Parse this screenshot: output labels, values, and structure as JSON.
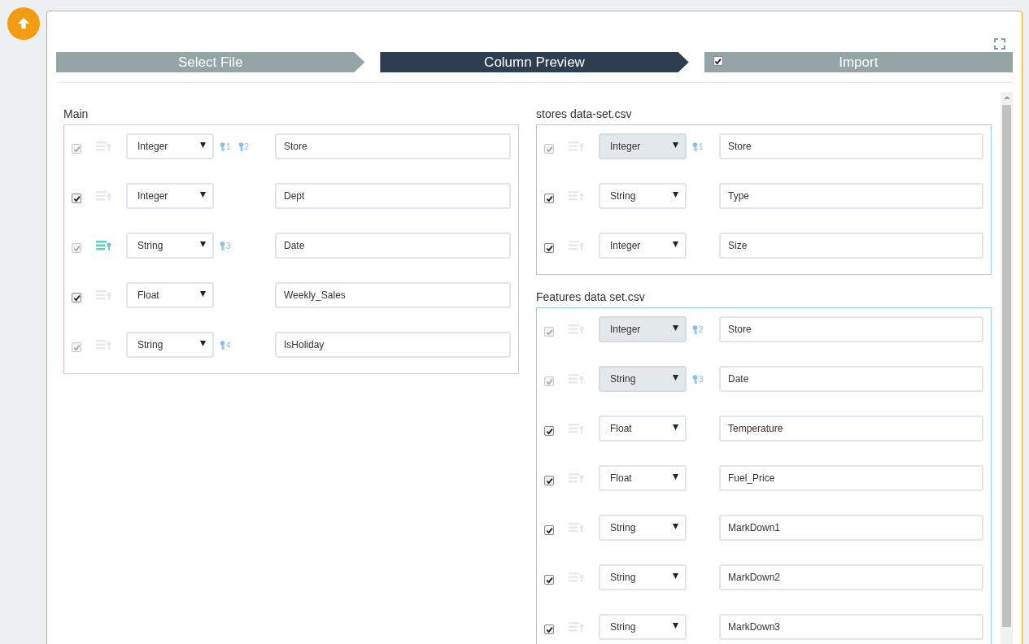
{
  "steps": [
    {
      "label": "Select File",
      "selected": false
    },
    {
      "label": "Column Preview",
      "selected": true
    },
    {
      "label": "Import",
      "selected": false,
      "checked": true
    }
  ],
  "panels": [
    {
      "kind": "main",
      "title": "Main",
      "rows": [
        {
          "checked": true,
          "checkbox_disabled": true,
          "indexed": false,
          "type": "Integer",
          "type_disabled": false,
          "keys": [
            "1",
            "2"
          ],
          "name": "Store"
        },
        {
          "checked": true,
          "checkbox_disabled": false,
          "indexed": false,
          "type": "Integer",
          "type_disabled": false,
          "keys": [],
          "name": "Dept"
        },
        {
          "checked": true,
          "checkbox_disabled": true,
          "indexed": true,
          "type": "String",
          "type_disabled": false,
          "keys": [
            "3"
          ],
          "name": "Date"
        },
        {
          "checked": true,
          "checkbox_disabled": false,
          "indexed": false,
          "type": "Float",
          "type_disabled": false,
          "keys": [],
          "name": "Weekly_Sales"
        },
        {
          "checked": true,
          "checkbox_disabled": true,
          "indexed": false,
          "type": "String",
          "type_disabled": false,
          "keys": [
            "4"
          ],
          "name": "IsHoliday"
        }
      ]
    },
    {
      "kind": "source",
      "title": "stores data-set.csv",
      "rows": [
        {
          "checked": true,
          "checkbox_disabled": true,
          "indexed": false,
          "type": "Integer",
          "type_disabled": true,
          "keys": [
            "1"
          ],
          "name": "Store"
        },
        {
          "checked": true,
          "checkbox_disabled": false,
          "indexed": false,
          "type": "String",
          "type_disabled": false,
          "keys": [],
          "name": "Type"
        },
        {
          "checked": true,
          "checkbox_disabled": false,
          "indexed": false,
          "type": "Integer",
          "type_disabled": false,
          "keys": [],
          "name": "Size"
        }
      ]
    },
    {
      "kind": "source",
      "title": "Features data set.csv",
      "rows": [
        {
          "checked": true,
          "checkbox_disabled": true,
          "indexed": false,
          "type": "Integer",
          "type_disabled": true,
          "keys": [
            "2"
          ],
          "name": "Store"
        },
        {
          "checked": true,
          "checkbox_disabled": true,
          "indexed": false,
          "type": "String",
          "type_disabled": true,
          "keys": [
            "3"
          ],
          "name": "Date"
        },
        {
          "checked": true,
          "checkbox_disabled": false,
          "indexed": false,
          "type": "Float",
          "type_disabled": false,
          "keys": [],
          "name": "Temperature"
        },
        {
          "checked": true,
          "checkbox_disabled": false,
          "indexed": false,
          "type": "Float",
          "type_disabled": false,
          "keys": [],
          "name": "Fuel_Price"
        },
        {
          "checked": true,
          "checkbox_disabled": false,
          "indexed": false,
          "type": "String",
          "type_disabled": false,
          "keys": [],
          "name": "MarkDown1"
        },
        {
          "checked": true,
          "checkbox_disabled": false,
          "indexed": false,
          "type": "String",
          "type_disabled": false,
          "keys": [],
          "name": "MarkDown2"
        },
        {
          "checked": true,
          "checkbox_disabled": false,
          "indexed": false,
          "type": "String",
          "type_disabled": false,
          "keys": [],
          "name": "MarkDown3"
        }
      ]
    }
  ]
}
